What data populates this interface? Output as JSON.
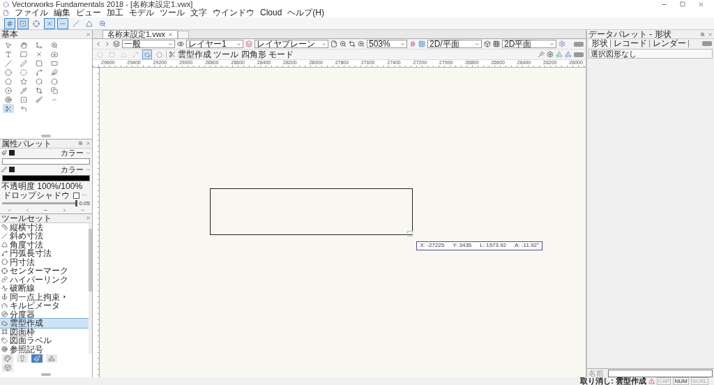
{
  "window": {
    "title": "Vectorworks Fundamentals 2018 - [名称未設定1.vwx]"
  },
  "menu": [
    "ファイル",
    "編集",
    "ビュー",
    "加工",
    "モデル",
    "ツール",
    "文字",
    "ウインドウ",
    "Cloud",
    "ヘルプ(H)"
  ],
  "snap_toolbar": [
    {
      "selected": true
    },
    {
      "selected": true
    },
    {
      "selected": false
    },
    {
      "selected": true
    },
    {
      "selected": true
    },
    {
      "selected": false
    },
    {
      "selected": false
    },
    {
      "selected": false
    }
  ],
  "basic_palette": {
    "title": "基本"
  },
  "attribute_palette": {
    "title": "属性パレット",
    "fill_label": "カラー",
    "pen_label": "カラー",
    "opacity": "不透明度 100%/100%",
    "drop_shadow": {
      "label": "ドロップシャドウ",
      "checked": false
    },
    "more": "···",
    "line_weight": {
      "level": 1,
      "value": "0.05"
    }
  },
  "tool_set": {
    "title": "ツールセット",
    "items": [
      {
        "label": "縦横寸法",
        "selected": false,
        "submenu": false
      },
      {
        "label": "斜め寸法",
        "selected": false,
        "submenu": false
      },
      {
        "label": "角度寸法",
        "selected": false,
        "submenu": false
      },
      {
        "label": "円弧長寸法",
        "selected": false,
        "submenu": false
      },
      {
        "label": "円寸法",
        "selected": false,
        "submenu": false
      },
      {
        "label": "センターマーク",
        "selected": false,
        "submenu": false
      },
      {
        "label": "ハイパーリンク",
        "selected": false,
        "submenu": false
      },
      {
        "label": "破断線",
        "selected": false,
        "submenu": false
      },
      {
        "label": "同一点上拘束",
        "selected": false,
        "submenu": true
      },
      {
        "label": "キルビメータ",
        "selected": false,
        "submenu": false
      },
      {
        "label": "分度器",
        "selected": false,
        "submenu": false
      },
      {
        "label": "雲型作成",
        "selected": true,
        "submenu": false
      },
      {
        "label": "図面枠",
        "selected": false,
        "submenu": false
      },
      {
        "label": "図面ラベル",
        "selected": false,
        "submenu": false
      },
      {
        "label": "参照記号",
        "selected": false,
        "submenu": false
      }
    ]
  },
  "document_tabs": [
    {
      "label": "名称未設定1.vwx",
      "selected": true
    }
  ],
  "view_bar": {
    "class": "一般",
    "layer": "レイヤー1",
    "plane": "レイヤプレーン",
    "zoom": "503%",
    "view": "2D/平面",
    "render": "2D平面"
  },
  "mode_bar": {
    "modes": [
      {
        "selected": false,
        "disabled": true
      },
      {
        "selected": false,
        "disabled": true
      },
      {
        "selected": false,
        "disabled": true
      },
      {
        "selected": false,
        "disabled": true
      },
      {
        "selected": true,
        "disabled": false
      },
      {
        "selected": false,
        "disabled": false
      }
    ],
    "hint": "雲型作成 ツール 四角形 モード"
  },
  "ruler": {
    "labels": [
      "29600",
      "29400",
      "29200",
      "29000",
      "28800",
      "28600",
      "28400",
      "28200",
      "28000",
      "27800",
      "27600",
      "27400",
      "27200",
      "27000",
      "26800",
      "26600",
      "26400",
      "26200",
      "26000"
    ]
  },
  "canvas": {
    "readout": {
      "x": "X: -27225",
      "y": "Y: 3435",
      "l": "L: 1573.92",
      "a": "A: -11.92°"
    }
  },
  "data_palette": {
    "title": "データパレット - 形状",
    "tabs": [
      {
        "label": "形状",
        "selected": true
      },
      {
        "label": "レコード",
        "selected": false
      },
      {
        "label": "レンダー",
        "selected": false
      }
    ],
    "selection": "選択図形なし",
    "name_label": "名前"
  },
  "status_bar": {
    "message": "取り消し: 雲型作成",
    "indicators": [
      {
        "label": "CAP",
        "on": false
      },
      {
        "label": "NUM",
        "on": true
      },
      {
        "label": "SCRL",
        "on": false
      }
    ]
  }
}
